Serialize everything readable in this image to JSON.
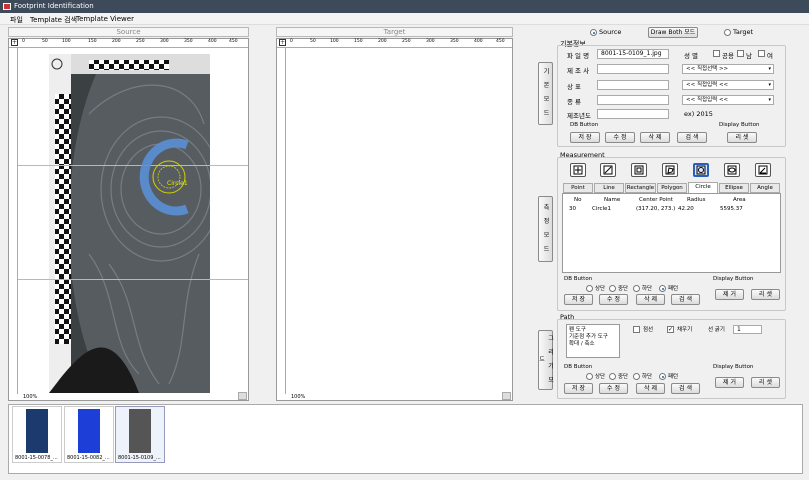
{
  "window": {
    "title": "Footprint Identification"
  },
  "menu": [
    "파일",
    "Template 검색",
    "Template Viewer"
  ],
  "panes": {
    "source": "Source",
    "target": "Target"
  },
  "ruler": {
    "ticks": [
      "0",
      "50",
      "100",
      "150",
      "200",
      "250",
      "300",
      "350",
      "400",
      "450"
    ],
    "zoom": "100%"
  },
  "overlay": {
    "circle_label": "Circle1"
  },
  "mode": {
    "source": "Source",
    "draw_both": "Draw Both 모드",
    "target": "Target"
  },
  "basic": {
    "section": "기본정보",
    "vertical": "기 본 모 드",
    "filename_label": "파 일 명",
    "filename": "8001-15-0109_1.jpg",
    "gender_label": "성   별",
    "g_common": "공용",
    "g_male": "남",
    "g_female": "여",
    "maker_label": "제 조 사",
    "product_label": "상    표",
    "type_label": "종    류",
    "year_label": "제조년도",
    "select_text": "<< 직접선택 >>",
    "select_text2": "<< 직접입력 <<",
    "year_hint": "ex) 2015",
    "db_button": "DB Button",
    "display_button": "Display Button",
    "save": "저 장",
    "edit": "수 정",
    "delete": "삭 제",
    "search": "검 색",
    "reset": "리 셋"
  },
  "measure": {
    "section": "Measurement",
    "vertical": "측 정 모 드",
    "tabs": [
      "Point",
      "Line",
      "Rectangle",
      "Polygon",
      "Circle",
      "Ellipse",
      "Angle"
    ],
    "columns": [
      "No",
      "Name",
      "Center Point",
      "Radius",
      "Area"
    ],
    "rows": [
      [
        "30",
        "Circle1",
        "(317.20, 273.)",
        "42.20",
        "5595.37"
      ]
    ],
    "db_button": "DB Button",
    "display_button": "Display Button",
    "r_top": "상단",
    "r_mid": "중단",
    "r_bottom": "하단",
    "r_full": "패턴",
    "save": "저 장",
    "edit": "수 정",
    "delete": "삭 제",
    "search": "검 색",
    "remove": "제 거",
    "reset": "리 셋"
  },
  "path": {
    "section": "Path",
    "vertical": "그 리 기 모 드",
    "tools": [
      "펜 도구",
      "기준점 추가 도구",
      "확대 / 축소"
    ],
    "dashed": "점선",
    "fill": "채우기",
    "line_width_label": "선 굵기",
    "line_width": "1",
    "db_button": "DB Button",
    "display_button": "Display Button",
    "r_top": "상단",
    "r_mid": "중단",
    "r_bottom": "하단",
    "r_full": "패턴",
    "save": "저 장",
    "edit": "수 정",
    "delete": "삭 제",
    "search": "검 색",
    "remove": "제 거",
    "reset": "리 셋"
  },
  "thumbnails": [
    {
      "label": "8001-15-0078_...",
      "color": "#1c3a6e"
    },
    {
      "label": "8001-15-0082_...",
      "color": "#1d3fd8"
    },
    {
      "label": "8001-15-0109_...",
      "color": "#555555"
    }
  ],
  "colors": {
    "accent": "#2a5fbf",
    "guide": "#7fd0d0",
    "circle": "#5a8fd6"
  }
}
